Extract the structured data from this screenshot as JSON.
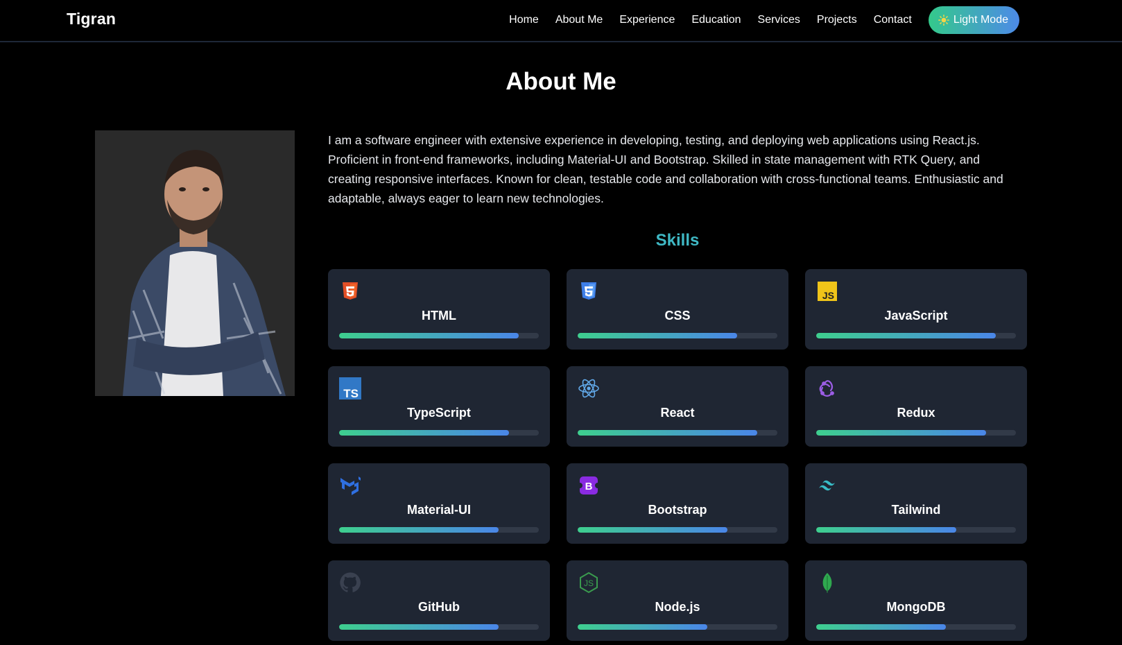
{
  "nav": {
    "brand": "Tigran",
    "links": [
      "Home",
      "About Me",
      "Experience",
      "Education",
      "Services",
      "Projects",
      "Contact"
    ],
    "mode_button": "Light Mode",
    "mode_icon": "sun-icon"
  },
  "about": {
    "title": "About Me",
    "bio": "I am a software engineer with extensive experience in developing, testing, and deploying web applications using React.js. Proficient in front-end frameworks, including Material-UI and Bootstrap. Skilled in state management with RTK Query, and creating responsive interfaces. Known for clean, testable code and collaboration with cross-functional teams. Enthusiastic and adaptable, always eager to learn new technologies.",
    "photo_alt": "profile-photo"
  },
  "skills": {
    "title": "Skills",
    "items": [
      {
        "name": "HTML",
        "level": 0.9,
        "icon": "html5-icon",
        "color": "#e34f26"
      },
      {
        "name": "CSS",
        "level": 0.8,
        "icon": "css3-icon",
        "color": "#3d7ee8"
      },
      {
        "name": "JavaScript",
        "level": 0.9,
        "icon": "javascript-icon",
        "color": "#f0c419"
      },
      {
        "name": "TypeScript",
        "level": 0.85,
        "icon": "typescript-icon",
        "color": "#3178c6"
      },
      {
        "name": "React",
        "level": 0.9,
        "icon": "react-icon",
        "color": "#61a8e8"
      },
      {
        "name": "Redux",
        "level": 0.85,
        "icon": "redux-icon",
        "color": "#9b5de5"
      },
      {
        "name": "Material-UI",
        "level": 0.8,
        "icon": "material-ui-icon",
        "color": "#2f6fe0"
      },
      {
        "name": "Bootstrap",
        "level": 0.75,
        "icon": "bootstrap-icon",
        "color": "#8a2be2"
      },
      {
        "name": "Tailwind",
        "level": 0.7,
        "icon": "tailwind-icon",
        "color": "#38bdc8"
      },
      {
        "name": "GitHub",
        "level": 0.8,
        "icon": "github-icon",
        "color": "#3a4150"
      },
      {
        "name": "Node.js",
        "level": 0.65,
        "icon": "nodejs-icon",
        "color": "#3a9a4e"
      },
      {
        "name": "MongoDB",
        "level": 0.65,
        "icon": "mongodb-icon",
        "color": "#2fa84f"
      }
    ]
  }
}
